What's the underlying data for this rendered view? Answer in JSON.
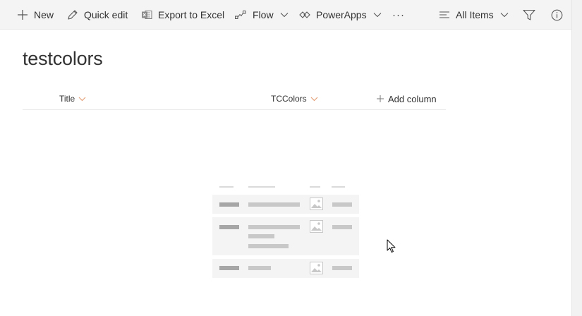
{
  "commandbar": {
    "new_label": "New",
    "quick_edit_label": "Quick edit",
    "export_label": "Export to Excel",
    "flow_label": "Flow",
    "powerapps_label": "PowerApps",
    "more_label": "···",
    "view_label": "All Items"
  },
  "page": {
    "title": "testcolors"
  },
  "columns": {
    "title_label": "Title",
    "tccolors_label": "TCColors",
    "add_column_label": "Add column"
  },
  "icons": {
    "new": "plus-icon",
    "quick_edit": "pencil-icon",
    "export": "excel-icon",
    "flow": "flow-icon",
    "powerapps": "powerapps-icon",
    "view": "list-view-icon",
    "filter": "filter-icon",
    "info": "info-icon"
  },
  "colors": {
    "commandbar_bg": "#f4f4f4",
    "sort_chevron": "#e3a27a",
    "placeholder_dark": "#a6a6a6",
    "placeholder_light": "#c8c8c8",
    "placeholder_bg": "#f4f4f4"
  }
}
